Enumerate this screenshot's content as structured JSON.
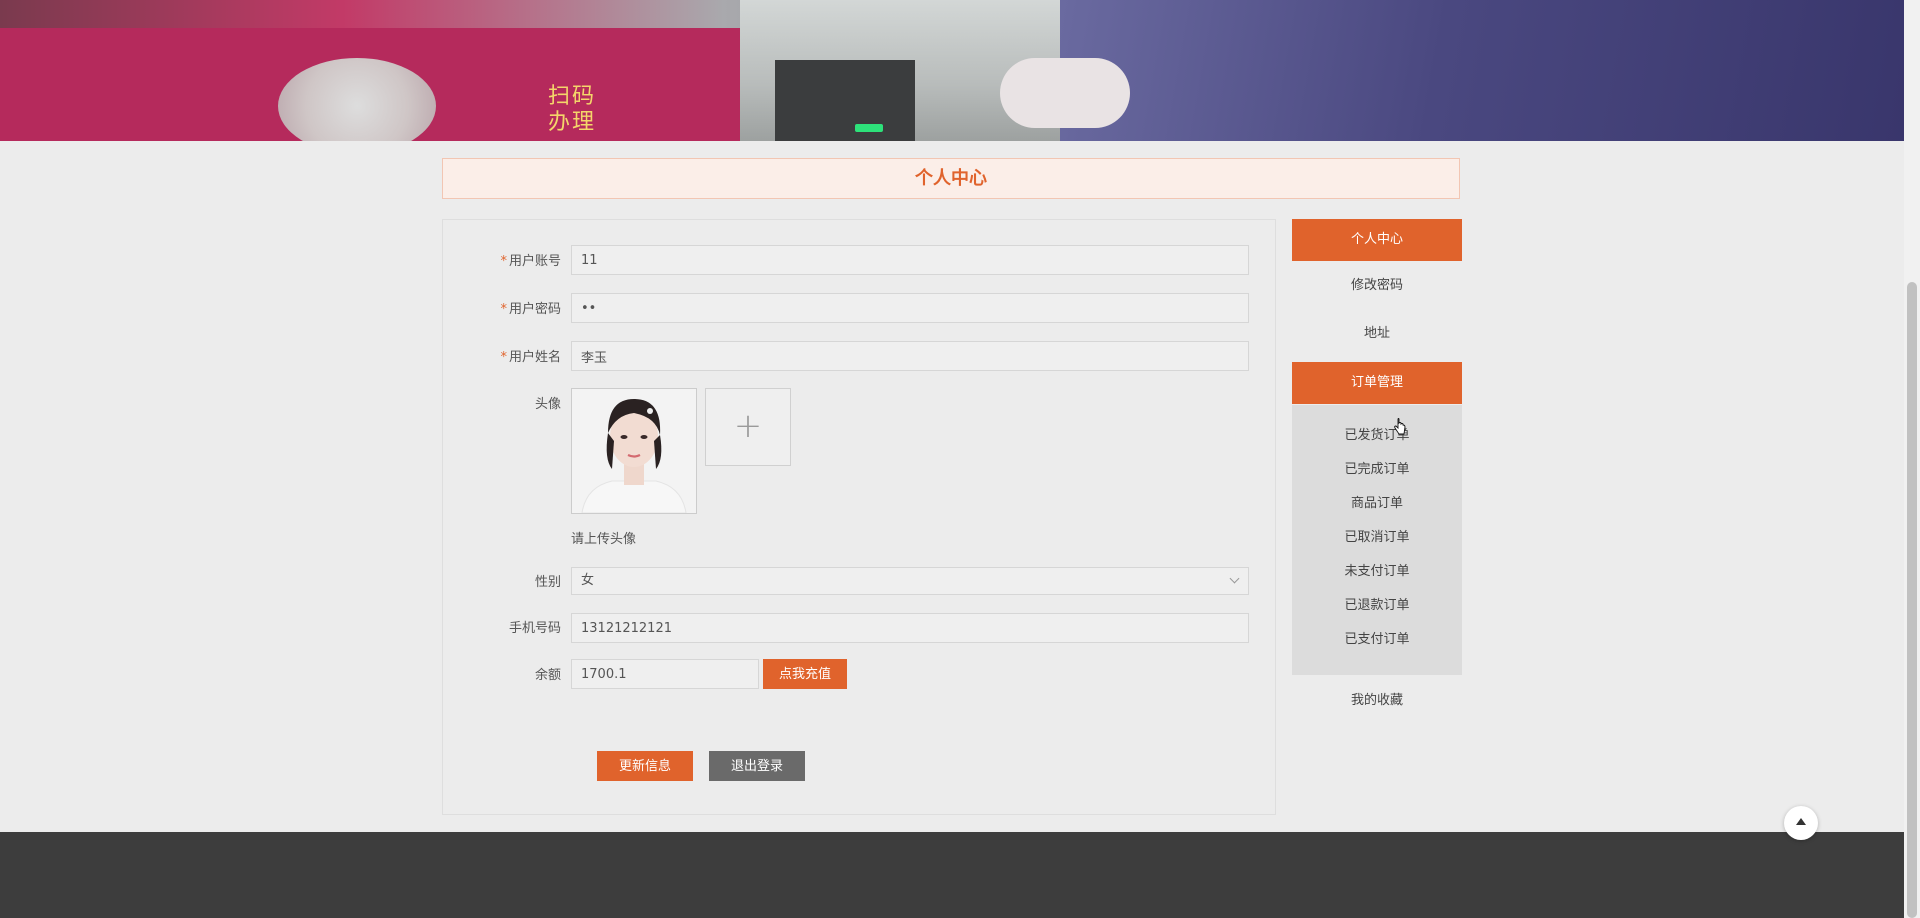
{
  "page_title": "个人中心",
  "banner": {
    "text_line1": "扫码",
    "text_line2": "办理"
  },
  "form": {
    "account": {
      "label": "用户账号",
      "required": true,
      "value": "11"
    },
    "password": {
      "label": "用户密码",
      "required": true,
      "value": "••"
    },
    "name": {
      "label": "用户姓名",
      "required": true,
      "value": "李玉"
    },
    "avatar": {
      "label": "头像",
      "upload_icon": "plus-icon",
      "tip": "请上传头像"
    },
    "gender": {
      "label": "性别",
      "value": "女"
    },
    "phone": {
      "label": "手机号码",
      "value": "13121212121"
    },
    "balance": {
      "label": "余额",
      "value": "1700.1",
      "recharge_label": "点我充值"
    },
    "update_label": "更新信息",
    "logout_label": "退出登录"
  },
  "menu": {
    "personal_center": "个人中心",
    "change_password": "修改密码",
    "address": "地址",
    "order_management": "订单管理",
    "orders": [
      "已发货订单",
      "已完成订单",
      "商品订单",
      "已取消订单",
      "未支付订单",
      "已退款订单",
      "已支付订单"
    ],
    "favorites": "我的收藏"
  },
  "colors": {
    "accent": "#e0632c",
    "gray_button": "#6a6a6a",
    "footer": "#3d3d3d"
  }
}
